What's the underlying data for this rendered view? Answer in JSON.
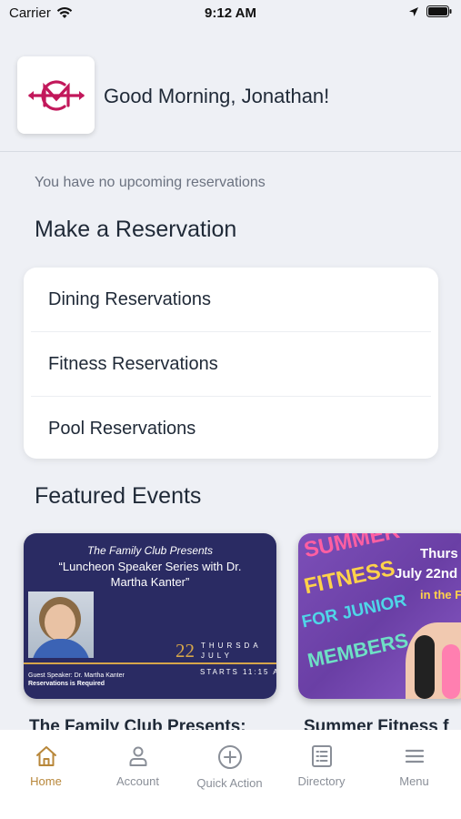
{
  "status_bar": {
    "carrier": "Carrier",
    "time": "9:12 AM"
  },
  "header": {
    "greeting": "Good Morning, Jonathan!",
    "logo_alt": "club-crest-logo"
  },
  "reservations": {
    "empty_message": "You have no upcoming reservations",
    "title": "Make a Reservation",
    "items": [
      {
        "label": "Dining Reservations"
      },
      {
        "label": "Fitness Reservations"
      },
      {
        "label": "Pool Reservations"
      }
    ]
  },
  "events": {
    "title": "Featured Events",
    "cards": [
      {
        "title": "The Family Club Presents:",
        "flyer": {
          "presents": "The Family Club Presents",
          "headline": "“Luncheon Speaker Series with Dr. Martha Kanter”",
          "day_num": "22",
          "day_name": "THURSDA",
          "month": "JULY",
          "starts": "STARTS 11:15 A",
          "guest": "Guest Speaker: Dr. Martha Kanter",
          "reservations": "Reservations is Required"
        }
      },
      {
        "title": "Summer Fitness f",
        "flyer": {
          "line1": "SUMMER",
          "line2": "FITNESS",
          "line3": "FOR JUNIOR",
          "line4": "MEMBERS",
          "date1": "Thurs",
          "date2": "July 22nd",
          "date3": "in the Fi"
        }
      }
    ]
  },
  "tab_bar": {
    "tabs": [
      {
        "label": "Home",
        "icon": "home-icon",
        "active": true
      },
      {
        "label": "Account",
        "icon": "person-icon",
        "active": false
      },
      {
        "label": "Quick Action",
        "icon": "plus-circle-icon",
        "active": false
      },
      {
        "label": "Directory",
        "icon": "directory-list-icon",
        "active": false
      },
      {
        "label": "Menu",
        "icon": "hamburger-icon",
        "active": false
      }
    ]
  },
  "colors": {
    "accent": "#b8873a",
    "brand": "#c2185b",
    "background": "#eef0f5",
    "flyer_navy": "#2a2b63"
  }
}
